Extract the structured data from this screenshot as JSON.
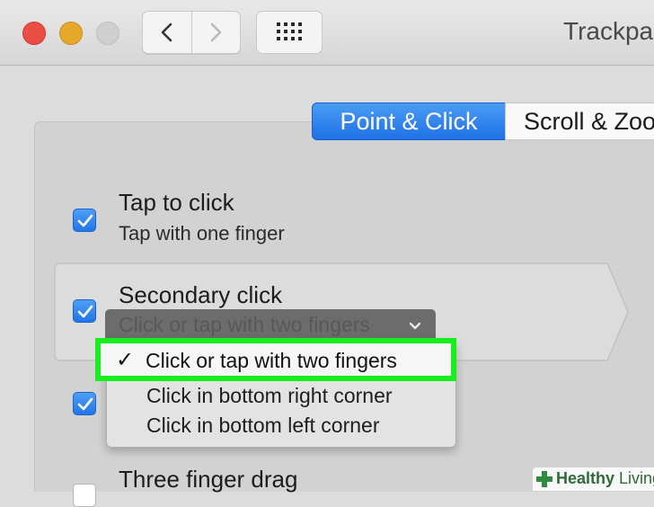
{
  "window": {
    "title": "Trackpa"
  },
  "toolbar": {
    "back_label": "",
    "forward_label": ""
  },
  "tabs": [
    {
      "label": "Point & Click",
      "selected": true
    },
    {
      "label": "Scroll & Zoo",
      "selected": false
    }
  ],
  "options": [
    {
      "label": "Tap to click",
      "subtitle": "Tap with one finger",
      "checked": true
    },
    {
      "label": "Secondary click",
      "checked": true
    },
    {
      "label": "",
      "checked": true
    },
    {
      "label": "Three finger drag",
      "checked": false
    }
  ],
  "secondary_click_popup": {
    "selected_value": "Click or tap with two fingers",
    "menu_items": [
      {
        "label": "Click or tap with two fingers",
        "selected": true
      },
      {
        "label": "Click in bottom right corner",
        "selected": false
      },
      {
        "label": "Click in bottom left corner",
        "selected": false
      }
    ]
  },
  "watermark": {
    "part1": "Healthy",
    "part2": " Living"
  },
  "colors": {
    "accent": "#2176e7",
    "highlight": "#17ee1d",
    "close": "#ea4d43",
    "minimize": "#e5a82b"
  },
  "icons": [
    "close-button",
    "minimize-button",
    "zoom-button",
    "chevron-left-icon",
    "chevron-right-icon",
    "grid-icon",
    "checkmark-icon",
    "chevron-down-icon",
    "cross-icon"
  ]
}
